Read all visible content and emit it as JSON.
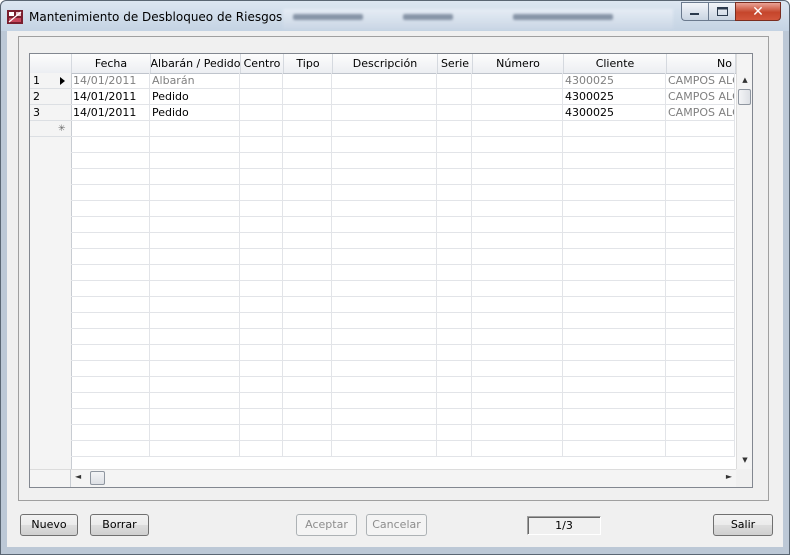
{
  "window": {
    "title": "Mantenimiento de Desbloqueo de Riesgos",
    "controls": [
      "minimize",
      "maximize",
      "close"
    ]
  },
  "grid": {
    "columns": [
      "Fecha",
      "Albarán / Pedido",
      "Centro",
      "Tipo",
      "Descripción",
      "Serie",
      "Número",
      "Cliente",
      "No"
    ],
    "rows": [
      {
        "num": "1",
        "current": true,
        "muted": true,
        "cells": [
          "14/01/2011",
          "Albarán",
          "",
          "",
          "",
          "",
          "",
          "4300025",
          "CAMPOS ALC"
        ]
      },
      {
        "num": "2",
        "current": false,
        "muted": false,
        "cells": [
          "14/01/2011",
          "Pedido",
          "",
          "",
          "",
          "",
          "",
          "4300025",
          "CAMPOS ALC"
        ]
      },
      {
        "num": "3",
        "current": false,
        "muted": false,
        "cells": [
          "14/01/2011",
          "Pedido",
          "",
          "",
          "",
          "",
          "",
          "4300025",
          "CAMPOS ALC"
        ]
      }
    ],
    "new_row_marker": "✳"
  },
  "buttons": {
    "nuevo": "Nuevo",
    "borrar": "Borrar",
    "aceptar": "Aceptar",
    "cancelar": "Cancelar",
    "salir": "Salir"
  },
  "pager": "1/3"
}
